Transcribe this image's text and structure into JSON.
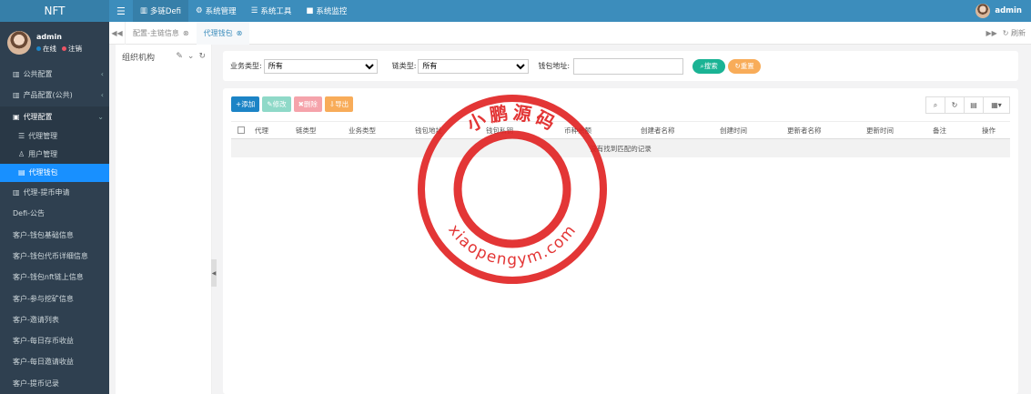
{
  "brand": "NFT",
  "topnav": [
    {
      "icon": "menu-icon",
      "label": ""
    },
    {
      "icon": "chart-icon",
      "label": "多链Defi"
    },
    {
      "icon": "gear-icon",
      "label": "系统管理"
    },
    {
      "icon": "list-icon",
      "label": "系统工具"
    },
    {
      "icon": "video-icon",
      "label": "系统监控"
    }
  ],
  "user": {
    "name": "admin",
    "online": "在线",
    "logout": "注销"
  },
  "sidebar": {
    "items": [
      {
        "label": "公共配置",
        "icon": "bank-icon"
      },
      {
        "label": "产品配置(公共)",
        "icon": "chart-icon"
      },
      {
        "label": "代理配置",
        "icon": "image-icon"
      }
    ],
    "sub": [
      {
        "label": "代理管理",
        "icon": "list-icon"
      },
      {
        "label": "用户管理",
        "icon": "user-icon"
      },
      {
        "label": "代理钱包",
        "icon": "book-icon"
      }
    ],
    "rest": [
      "代理-提币申请",
      "Defi-公告",
      "客户-钱包基础信息",
      "客户-钱包代币详细信息",
      "客户-钱包nft链上信息",
      "客户-参与挖矿信息",
      "客户-邀请列表",
      "客户-每日存币收益",
      "客户-每日邀请收益",
      "客户-提币记录"
    ]
  },
  "tabs": {
    "home": "配置-主链信息",
    "current": "代理钱包",
    "refresh": "刷新"
  },
  "tree": {
    "title": "组织机构"
  },
  "search": {
    "biz_label": "业务类型:",
    "biz_value": "所有",
    "chain_label": "链类型:",
    "chain_value": "所有",
    "addr_label": "钱包地址:",
    "addr_value": "",
    "search_btn": "搜索",
    "reset_btn": "重置"
  },
  "toolbar": {
    "add": "添加",
    "edit": "修改",
    "delete": "删除",
    "export": "导出"
  },
  "table": {
    "columns": [
      "代理",
      "链类型",
      "业务类型",
      "钱包地址",
      "钱包私钥",
      "币种余额",
      "创建者名称",
      "创建时间",
      "更新者名称",
      "更新时间",
      "备注",
      "操作"
    ],
    "empty": "没有找到匹配的记录"
  },
  "watermark": {
    "cn": "小鹏源码",
    "url": "xiaopengym.com"
  },
  "colors": {
    "topbar": "#3c8dbc",
    "sidebar": "#2f4050",
    "selected": "#1890ff",
    "add": "#1c84c6",
    "edit": "#1ab394",
    "delete": "#ed5565",
    "export": "#f8ac59"
  }
}
